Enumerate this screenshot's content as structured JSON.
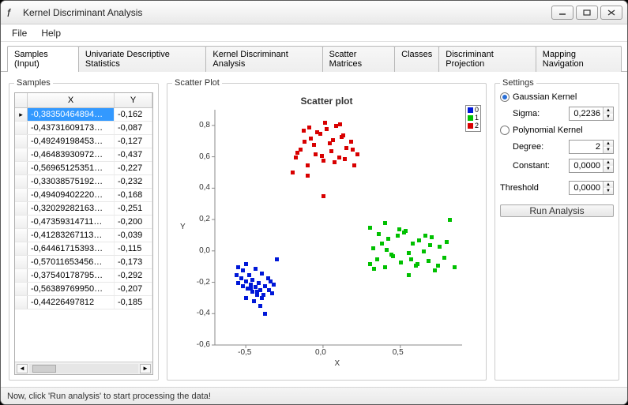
{
  "window": {
    "title": "Kernel Discriminant Analysis"
  },
  "menu": {
    "file": "File",
    "help": "Help"
  },
  "tabs": [
    "Samples (Input)",
    "Univariate Descriptive Statistics",
    "Kernel Discriminant Analysis",
    "Scatter Matrices",
    "Classes",
    "Discriminant Projection",
    "Mapping Navigation"
  ],
  "active_tab": 0,
  "samples": {
    "group_label": "Samples",
    "columns": {
      "x": "X",
      "y": "Y"
    },
    "rows": [
      {
        "x": "-0,38350464894…",
        "y": "-0,162"
      },
      {
        "x": "-0,43731609173…",
        "y": "-0,087"
      },
      {
        "x": "-0,49249198453…",
        "y": "-0,127"
      },
      {
        "x": "-0,46483930972…",
        "y": "-0,437"
      },
      {
        "x": "-0,56965125351…",
        "y": "-0,227"
      },
      {
        "x": "-0,33038575192…",
        "y": "-0,232"
      },
      {
        "x": "-0,49409402220…",
        "y": "-0,168"
      },
      {
        "x": "-0,32029282163…",
        "y": "-0,251"
      },
      {
        "x": "-0,47359314711…",
        "y": "-0,200"
      },
      {
        "x": "-0,41283267113…",
        "y": "-0,039"
      },
      {
        "x": "-0,64461715393…",
        "y": "-0,115"
      },
      {
        "x": "-0,57011653456…",
        "y": "-0,173"
      },
      {
        "x": "-0,37540178795…",
        "y": "-0,292"
      },
      {
        "x": "-0,56389769950…",
        "y": "-0,207"
      },
      {
        "x": "-0,44226497812",
        "y": "-0,185"
      }
    ]
  },
  "plot": {
    "group_label": "Scatter Plot",
    "title": "Scatter plot",
    "xlabel": "X",
    "ylabel": "Y",
    "x_ticks": [
      "-0,5",
      "0,0",
      "0,5"
    ],
    "y_ticks": [
      "-0,6",
      "-0,4",
      "-0,2",
      "0,0",
      "0,2",
      "0,4",
      "0,6",
      "0,8"
    ],
    "legend": [
      {
        "label": "0",
        "color": "#0018d8"
      },
      {
        "label": "1",
        "color": "#00c000"
      },
      {
        "label": "2",
        "color": "#d80000"
      }
    ]
  },
  "chart_data": {
    "type": "scatter",
    "title": "Scatter plot",
    "xlabel": "X",
    "ylabel": "Y",
    "xlim": [
      -0.7,
      0.9
    ],
    "ylim": [
      -0.6,
      0.9
    ],
    "series": [
      {
        "name": "0",
        "color": "#0018d8",
        "x": [
          -0.55,
          -0.52,
          -0.5,
          -0.48,
          -0.46,
          -0.44,
          -0.42,
          -0.4,
          -0.38,
          -0.36,
          -0.35,
          -0.34,
          -0.33,
          -0.32,
          -0.5,
          -0.47,
          -0.45,
          -0.43,
          -0.41,
          -0.39,
          -0.55,
          -0.52,
          -0.49,
          -0.46,
          -0.43,
          -0.4,
          -0.56,
          -0.53,
          -0.5,
          -0.47,
          -0.44,
          -0.41,
          -0.38,
          -0.3
        ],
        "y": [
          -0.1,
          -0.12,
          -0.08,
          -0.15,
          -0.18,
          -0.11,
          -0.2,
          -0.14,
          -0.22,
          -0.17,
          -0.25,
          -0.19,
          -0.27,
          -0.21,
          -0.3,
          -0.24,
          -0.32,
          -0.26,
          -0.35,
          -0.28,
          -0.2,
          -0.22,
          -0.24,
          -0.26,
          -0.28,
          -0.3,
          -0.15,
          -0.17,
          -0.19,
          -0.21,
          -0.23,
          -0.25,
          -0.4,
          -0.05
        ]
      },
      {
        "name": "1",
        "color": "#00c000",
        "x": [
          0.3,
          0.32,
          0.35,
          0.38,
          0.4,
          0.42,
          0.45,
          0.48,
          0.5,
          0.52,
          0.55,
          0.58,
          0.6,
          0.62,
          0.65,
          0.68,
          0.7,
          0.72,
          0.75,
          0.78,
          0.8,
          0.36,
          0.44,
          0.53,
          0.61,
          0.69,
          0.33,
          0.41,
          0.49,
          0.57,
          0.66,
          0.74,
          0.82,
          0.3,
          0.85,
          0.4,
          0.55
        ],
        "y": [
          -0.08,
          0.02,
          -0.05,
          0.05,
          -0.1,
          0.08,
          -0.03,
          0.1,
          -0.07,
          0.12,
          -0.01,
          0.05,
          -0.09,
          0.07,
          0.0,
          -0.06,
          0.09,
          -0.12,
          0.03,
          -0.04,
          0.06,
          0.11,
          -0.02,
          0.13,
          -0.08,
          0.04,
          -0.11,
          0.01,
          0.14,
          -0.05,
          0.1,
          -0.09,
          0.2,
          0.15,
          -0.1,
          0.18,
          -0.15
        ]
      },
      {
        "name": "2",
        "color": "#d80000",
        "x": [
          -0.18,
          -0.15,
          -0.12,
          -0.1,
          -0.08,
          -0.05,
          -0.02,
          0.0,
          0.02,
          0.05,
          0.08,
          0.1,
          0.12,
          0.15,
          0.18,
          0.2,
          -0.13,
          -0.06,
          0.01,
          0.07,
          0.13,
          -0.17,
          -0.09,
          -0.01,
          0.06,
          0.14,
          -0.2,
          -0.04,
          0.04,
          0.11,
          0.19,
          0.22,
          0.0,
          -0.1
        ],
        "y": [
          0.6,
          0.65,
          0.7,
          0.55,
          0.72,
          0.62,
          0.75,
          0.58,
          0.78,
          0.64,
          0.8,
          0.6,
          0.73,
          0.66,
          0.7,
          0.55,
          0.77,
          0.68,
          0.82,
          0.57,
          0.74,
          0.63,
          0.79,
          0.61,
          0.71,
          0.59,
          0.5,
          0.76,
          0.69,
          0.81,
          0.65,
          0.62,
          0.35,
          0.48
        ]
      }
    ]
  },
  "settings": {
    "group_label": "Settings",
    "gaussian": {
      "label": "Gaussian Kernel",
      "checked": true,
      "sigma_label": "Sigma:",
      "sigma": "0,2236"
    },
    "polynomial": {
      "label": "Polynomial Kernel",
      "checked": false,
      "degree_label": "Degree:",
      "degree": "2",
      "constant_label": "Constant:",
      "constant": "0,0000"
    },
    "threshold_label": "Threshold",
    "threshold": "0,0000",
    "run_label": "Run Analysis"
  },
  "status": "Now, click 'Run analysis' to start processing the data!"
}
